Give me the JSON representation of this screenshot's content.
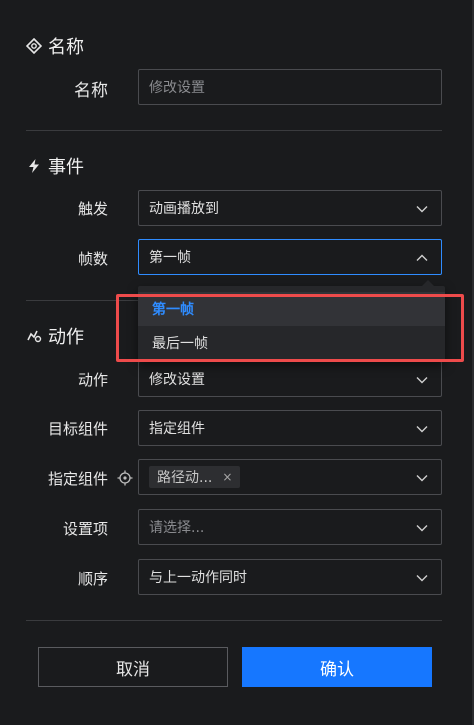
{
  "sections": {
    "name": {
      "title": "名称",
      "icon": "diamond-target-icon"
    },
    "event": {
      "title": "事件",
      "icon": "lightning-icon"
    },
    "action": {
      "title": "动作",
      "icon": "action-icon"
    }
  },
  "name_field": {
    "label": "名称",
    "placeholder": "修改设置"
  },
  "trigger_field": {
    "label": "触发",
    "value": "动画播放到"
  },
  "frames_field": {
    "label": "帧数",
    "value": "第一帧"
  },
  "frames_dropdown": {
    "options": [
      "第一帧",
      "最后一帧"
    ],
    "selected": "第一帧"
  },
  "action_field": {
    "label": "动作",
    "value": "修改设置"
  },
  "target_component_field": {
    "label": "目标组件",
    "value": "指定组件"
  },
  "specified_component_field": {
    "label": "指定组件",
    "tag": "路径动...",
    "tag_close": "×"
  },
  "setting_item_field": {
    "label": "设置项",
    "placeholder": "请选择..."
  },
  "order_field": {
    "label": "顺序",
    "value": "与上一动作同时"
  },
  "buttons": {
    "cancel": "取消",
    "confirm": "确认"
  },
  "colors": {
    "accent": "#1677ff",
    "highlight": "#ee4b4b",
    "background": "#1a1b1d"
  }
}
